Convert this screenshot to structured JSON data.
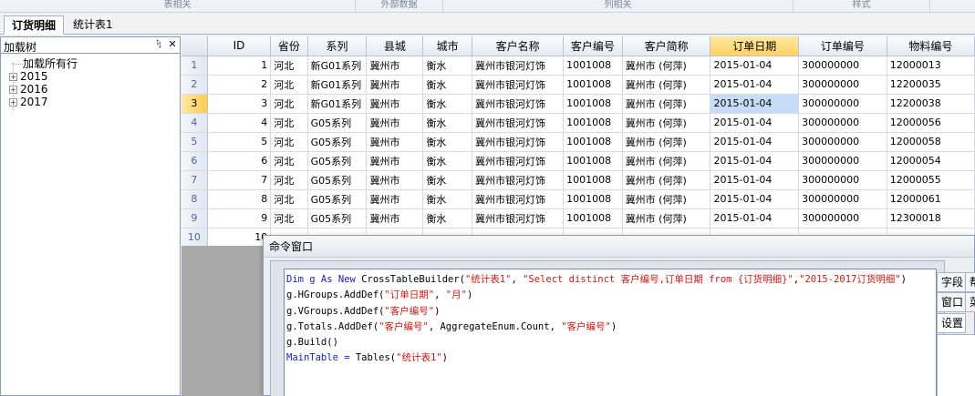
{
  "ribbon_groups": [
    "表相关",
    "外部数据",
    "列相关",
    "样式"
  ],
  "doc_tabs": [
    {
      "label": "订货明细",
      "active": true
    },
    {
      "label": "统计表1",
      "active": false
    }
  ],
  "tree": {
    "title": "加载树",
    "pin_glyph": "ᛪ",
    "close_glyph": "✕",
    "nodes": [
      {
        "label": "加载所有行",
        "expandable": false
      },
      {
        "label": "2015",
        "expandable": true
      },
      {
        "label": "2016",
        "expandable": true
      },
      {
        "label": "2017",
        "expandable": true
      }
    ]
  },
  "grid": {
    "columns": [
      "ID",
      "省份",
      "系列",
      "县城",
      "城市",
      "客户名称",
      "客户编号",
      "客户简称",
      "订单日期",
      "订单编号",
      "物料编号"
    ],
    "active_column": 8,
    "active_row": 3,
    "rows": [
      {
        "n": "1",
        "cells": [
          "1",
          "河北",
          "新G01系列",
          "冀州市",
          "衡水",
          "冀州市银河灯饰",
          "1001008",
          "冀州市 (何萍)",
          "2015-01-04",
          "300000000",
          "12000013"
        ]
      },
      {
        "n": "2",
        "cells": [
          "2",
          "河北",
          "新G01系列",
          "冀州市",
          "衡水",
          "冀州市银河灯饰",
          "1001008",
          "冀州市 (何萍)",
          "2015-01-04",
          "300000000",
          "12200035"
        ]
      },
      {
        "n": "3",
        "cells": [
          "3",
          "河北",
          "新G01系列",
          "冀州市",
          "衡水",
          "冀州市银河灯饰",
          "1001008",
          "冀州市 (何萍)",
          "2015-01-04",
          "300000000",
          "12200038"
        ]
      },
      {
        "n": "4",
        "cells": [
          "4",
          "河北",
          "G05系列",
          "冀州市",
          "衡水",
          "冀州市银河灯饰",
          "1001008",
          "冀州市 (何萍)",
          "2015-01-04",
          "300000000",
          "12000056"
        ]
      },
      {
        "n": "5",
        "cells": [
          "5",
          "河北",
          "G05系列",
          "冀州市",
          "衡水",
          "冀州市银河灯饰",
          "1001008",
          "冀州市 (何萍)",
          "2015-01-04",
          "300000000",
          "12000058"
        ]
      },
      {
        "n": "6",
        "cells": [
          "6",
          "河北",
          "G05系列",
          "冀州市",
          "衡水",
          "冀州市银河灯饰",
          "1001008",
          "冀州市 (何萍)",
          "2015-01-04",
          "300000000",
          "12000054"
        ]
      },
      {
        "n": "7",
        "cells": [
          "7",
          "河北",
          "G05系列",
          "冀州市",
          "衡水",
          "冀州市银河灯饰",
          "1001008",
          "冀州市 (何萍)",
          "2015-01-04",
          "300000000",
          "12000055"
        ]
      },
      {
        "n": "8",
        "cells": [
          "8",
          "河北",
          "G05系列",
          "冀州市",
          "衡水",
          "冀州市银河灯饰",
          "1001008",
          "冀州市 (何萍)",
          "2015-01-04",
          "300000000",
          "12000061"
        ]
      },
      {
        "n": "9",
        "cells": [
          "9",
          "河北",
          "G05系列",
          "冀州市",
          "衡水",
          "冀州市银河灯饰",
          "1001008",
          "冀州市 (何萍)",
          "2015-01-04",
          "300000000",
          "12300018"
        ]
      },
      {
        "n": "10",
        "cells": [
          "10",
          "",
          "",
          "",
          "",
          "",
          "",
          "",
          "",
          "",
          ""
        ]
      }
    ]
  },
  "command_window": {
    "title": "命令窗口",
    "code": [
      [
        {
          "t": "Dim g As New ",
          "c": "kw"
        },
        {
          "t": "CrossTableBuilder(",
          "c": ""
        },
        {
          "t": "\"统计表1\"",
          "c": "str"
        },
        {
          "t": ", ",
          "c": ""
        },
        {
          "t": "\"Select distinct 客户编号,订单日期 from {订货明细}\"",
          "c": "str"
        },
        {
          "t": ",",
          "c": ""
        },
        {
          "t": "\"2015-2017订货明细\"",
          "c": "str"
        },
        {
          "t": ")",
          "c": ""
        }
      ],
      [
        {
          "t": "g.HGroups.AddDef(",
          "c": ""
        },
        {
          "t": "\"订单日期\"",
          "c": "str"
        },
        {
          "t": ", ",
          "c": ""
        },
        {
          "t": "\"月\"",
          "c": "str"
        },
        {
          "t": ")",
          "c": ""
        }
      ],
      [
        {
          "t": "g.VGroups.AddDef(",
          "c": ""
        },
        {
          "t": "\"客户编号\"",
          "c": "str"
        },
        {
          "t": ")",
          "c": ""
        }
      ],
      [
        {
          "t": "g.Totals.AddDef(",
          "c": ""
        },
        {
          "t": "\"客户编号\"",
          "c": "str"
        },
        {
          "t": ", AggregateEnum.Count, ",
          "c": ""
        },
        {
          "t": "\"客户编号\"",
          "c": "str"
        },
        {
          "t": ")",
          "c": ""
        }
      ],
      [
        {
          "t": "g.Build()",
          "c": ""
        }
      ],
      [
        {
          "t": "MainTable = ",
          "c": "kw"
        },
        {
          "t": "Tables(",
          "c": ""
        },
        {
          "t": "\"统计表1\"",
          "c": "str"
        },
        {
          "t": ")",
          "c": ""
        }
      ]
    ],
    "side_tabs": [
      "字段",
      "帮",
      "窗口",
      "菜",
      "设置"
    ]
  }
}
